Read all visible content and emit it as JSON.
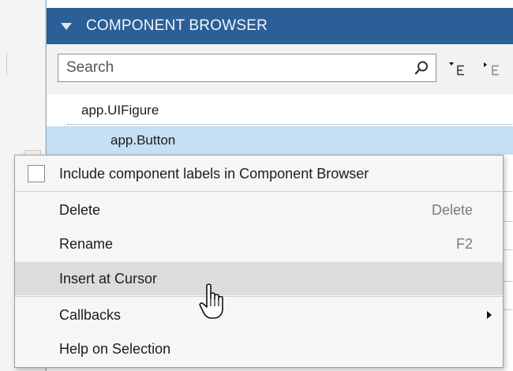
{
  "panel": {
    "title": "COMPONENT BROWSER",
    "header_color": "#2b5f97",
    "collapse_icon": "triangle-down-icon"
  },
  "search": {
    "placeholder": "Search",
    "value": "",
    "icon": "search-icon"
  },
  "toolbar": {
    "icons": [
      "tree-view-icon",
      "flat-view-icon"
    ]
  },
  "tree": {
    "items": [
      {
        "label": "app.UIFigure",
        "selected": false
      },
      {
        "label": "app.Button",
        "selected": true
      }
    ],
    "selection_color": "#c5dff4"
  },
  "context_menu": {
    "checkbox_item": {
      "label": "Include component labels in Component Browser",
      "checked": false
    },
    "items": [
      {
        "label": "Delete",
        "shortcut": "Delete"
      },
      {
        "label": "Rename",
        "shortcut": "F2"
      },
      {
        "label": "Insert at Cursor",
        "shortcut": "",
        "hovered": true
      },
      {
        "label": "Callbacks",
        "shortcut": "",
        "submenu": true
      },
      {
        "label": "Help on Selection",
        "shortcut": ""
      }
    ],
    "hover_color": "#dcdcdc"
  },
  "cursor": {
    "icon": "hand-pointer-icon"
  }
}
